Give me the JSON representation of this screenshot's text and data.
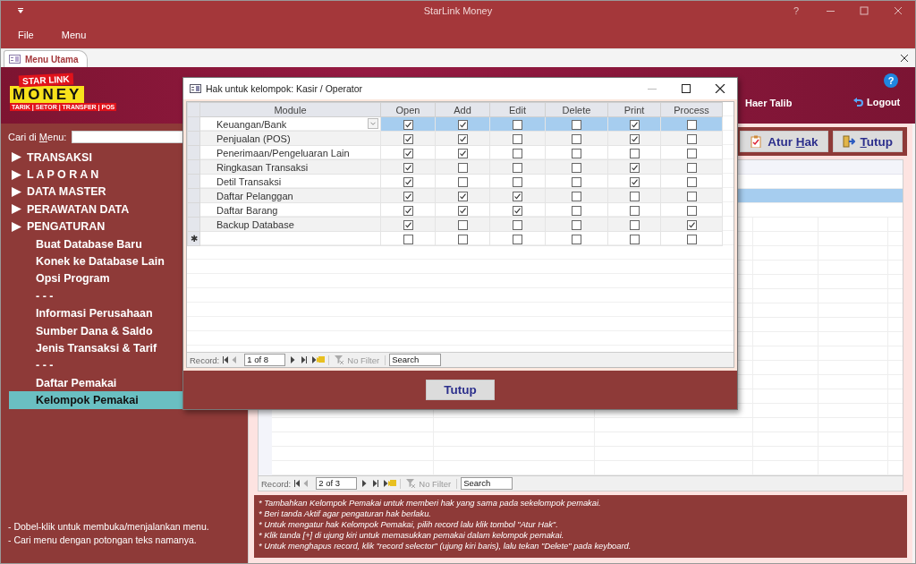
{
  "window": {
    "title": "StarLink Money",
    "help": "?"
  },
  "menu_bar": [
    {
      "label": "File"
    },
    {
      "label": "Menu"
    }
  ],
  "document_tab": {
    "label": "Menu Utama",
    "selected": true
  },
  "header": {
    "logo": {
      "line1": "STAR LINK",
      "line2": "MONEY",
      "tagline": "TARIK | SETOR | TRANSFER | POS"
    },
    "help": "?",
    "user": "Haer Talib",
    "logout": "Logout"
  },
  "sidebar": {
    "search_label": [
      {
        "text": "Cari di "
      },
      {
        "text": "M",
        "underlined": true
      },
      {
        "text": "enu:"
      }
    ],
    "items": [
      {
        "label": "TRANSAKSI",
        "kind": "group",
        "selected": false
      },
      {
        "label": "L A P O R A N",
        "kind": "group",
        "selected": false
      },
      {
        "label": "DATA MASTER",
        "kind": "group",
        "selected": false
      },
      {
        "label": "PERAWATAN DATA",
        "kind": "group",
        "selected": false
      },
      {
        "label": "PENGATURAN",
        "kind": "group",
        "selected": false
      },
      {
        "label": "Buat Database Baru",
        "kind": "item",
        "selected": false
      },
      {
        "label": "Konek ke Database Lain",
        "kind": "item",
        "selected": false
      },
      {
        "label": "Opsi Program",
        "kind": "item",
        "selected": false
      },
      {
        "label": "- - -",
        "kind": "item",
        "selected": false
      },
      {
        "label": "Informasi Perusahaan",
        "kind": "item",
        "selected": false
      },
      {
        "label": "Sumber Dana & Saldo",
        "kind": "item",
        "selected": false
      },
      {
        "label": "Jenis Transaksi & Tarif",
        "kind": "item",
        "selected": false
      },
      {
        "label": "- - -",
        "kind": "item",
        "selected": false
      },
      {
        "label": "Daftar Pemakai",
        "kind": "item",
        "selected": false
      },
      {
        "label": "Kelompok Pemakai",
        "kind": "item",
        "selected": true
      }
    ],
    "hints": [
      "- Dobel-klik untuk membuka/menjalankan menu.",
      "- Cari menu dengan potongan teks namanya."
    ]
  },
  "toolbar": {
    "buttons": [
      {
        "label": [
          {
            "text": "Atur "
          },
          {
            "text": "H",
            "underlined": true
          },
          {
            "text": "ak"
          }
        ],
        "kind": "clipboard"
      },
      {
        "label": [
          {
            "text": "T",
            "underlined": true
          },
          {
            "text": "utup"
          }
        ],
        "kind": "exit"
      }
    ]
  },
  "table": {
    "rows": [
      {
        "selected": false
      },
      {
        "selected": true
      },
      {
        "selected": false
      }
    ],
    "record_nav": {
      "label": "Record:",
      "position": "2 of 3",
      "filter": "No Filter",
      "search": "Search"
    }
  },
  "notes": [
    "* Tambahkan Kelompok Pemakai untuk memberi hak yang sama pada sekelompok pemakai.",
    "* Beri tanda Aktif agar pengaturan hak berlaku.",
    "* Untuk mengatur hak Kelompok Pemakai, pilih record lalu klik tombol \"Atur Hak\".",
    "* Klik tanda [+] di ujung kiri untuk memasukkan pemakai dalam kelompok pemakai.",
    "* Untuk menghapus record, klik \"record selector\" (ujung kiri baris), lalu tekan \"Delete\" pada keyboard."
  ],
  "dialog": {
    "title": "Hak untuk kelompok: Kasir / Operator",
    "columns": [
      "Module",
      "Open",
      "Add",
      "Edit",
      "Delete",
      "Print",
      "Process"
    ],
    "rows": [
      {
        "module": "Keuangan/Bank",
        "selected": true,
        "permissions": [
          true,
          true,
          false,
          false,
          true,
          false
        ]
      },
      {
        "module": "Penjualan (POS)",
        "selected": false,
        "permissions": [
          true,
          true,
          false,
          false,
          true,
          false
        ]
      },
      {
        "module": "Penerimaan/Pengeluaran Lain",
        "selected": false,
        "permissions": [
          true,
          true,
          false,
          false,
          false,
          false
        ]
      },
      {
        "module": "Ringkasan Transaksi",
        "selected": false,
        "permissions": [
          true,
          false,
          false,
          false,
          true,
          false
        ]
      },
      {
        "module": "Detil Transaksi",
        "selected": false,
        "permissions": [
          true,
          false,
          false,
          false,
          true,
          false
        ]
      },
      {
        "module": "Daftar Pelanggan",
        "selected": false,
        "permissions": [
          true,
          true,
          true,
          false,
          false,
          false
        ]
      },
      {
        "module": "Daftar Barang",
        "selected": false,
        "permissions": [
          true,
          true,
          true,
          false,
          false,
          false
        ]
      },
      {
        "module": "Backup Database",
        "selected": false,
        "permissions": [
          true,
          false,
          false,
          false,
          false,
          true
        ]
      }
    ],
    "new_row": {
      "marker": "✱",
      "permissions": [
        false,
        false,
        false,
        false,
        false,
        false
      ]
    },
    "record_nav": {
      "label": "Record:",
      "position": "1 of 8",
      "filter": "No Filter",
      "search": "Search"
    },
    "close_button": "Tutup"
  }
}
